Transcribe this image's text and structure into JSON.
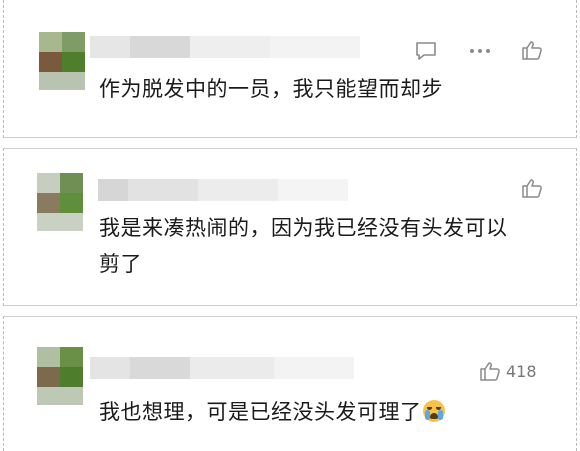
{
  "comments": [
    {
      "text": "作为脱发中的一员，我只能望而却步",
      "icons": [
        "reply-icon",
        "more-icon",
        "like-icon"
      ]
    },
    {
      "text_line1": "我是来凑热闹的，因为我已经没有头发可以",
      "text_line2": "剪了",
      "icons": [
        "like-icon"
      ]
    },
    {
      "text": "我也想理，可是已经没头发可理了",
      "emoji": "crying-face-icon",
      "likes": "418",
      "icons": [
        "like-icon"
      ]
    }
  ],
  "colors": {
    "text": "#1a1a1a",
    "icon": "#8a8a8a",
    "avatar_green": "#5c8a3c"
  }
}
